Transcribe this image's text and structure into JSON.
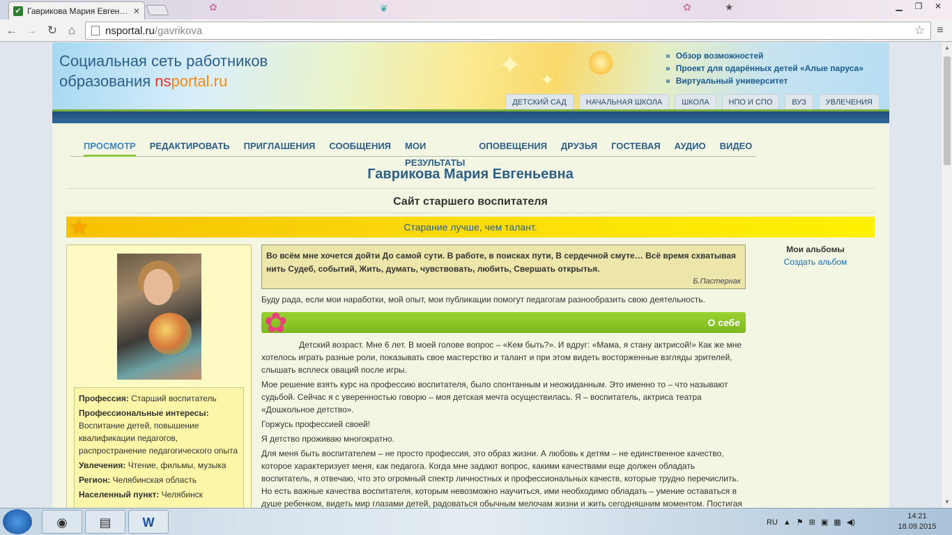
{
  "browser": {
    "tab_title": "Гаврикова Мария Евген…",
    "url_domain": "nsportal.ru",
    "url_path": "/gavrikova"
  },
  "site": {
    "brand_line1": "Социальная сеть работников",
    "brand_line2_prefix": "образования ",
    "brand_ns": "ns",
    "brand_portal": "portal.ru",
    "top_links": [
      "Обзор возможностей",
      "Проект для одарённых детей «Алые паруса»",
      "Виртуальный университет"
    ],
    "categories": [
      "ДЕТСКИЙ САД",
      "НАЧАЛЬНАЯ ШКОЛА",
      "ШКОЛА",
      "НПО И СПО",
      "ВУЗ",
      "УВЛЕЧЕНИЯ"
    ]
  },
  "profile_nav": [
    "ПРОСМОТР",
    "РЕДАКТИРОВАТЬ",
    "ПРИГЛАШЕНИЯ",
    "СООБЩЕНИЯ",
    "МОИ РЕЗУЛЬТАТЫ",
    "ОПОВЕЩЕНИЯ",
    "ДРУЗЬЯ",
    "ГОСТЕВАЯ",
    "АУДИО",
    "ВИДЕО"
  ],
  "profile": {
    "name": "Гаврикова Мария Евгеньевна",
    "site_title": "Сайт старшего воспитателя",
    "motto": "Старание лучше, чем талант.",
    "profession_label": "Профессия:",
    "profession": "Старший воспитатель",
    "interests_label": "Профессиональные интересы:",
    "interests": "Воспитание детей, повышение квалификации педагогов, распространение педагогического опыта",
    "hobbies_label": "Увлечения:",
    "hobbies": "Чтение, фильмы, музыка",
    "region_label": "Регион:",
    "region": "Челябинская область",
    "city_label": "Населенный пункт:",
    "city": "Челябинск"
  },
  "quote": {
    "text": "Во всём мне хочется дойти До самой сути. В работе, в поисках пути, В сердечной смуте… Всё время схватывая нить Судеб, событий, Жить, думать, чувствовать, любить, Свершать открытья.",
    "author": "Б.Пастернак"
  },
  "intro": "Буду рада, если мои наработки, мой опыт, мои публикации помогут педагогам разнообразить свою деятельность.",
  "about": {
    "label": "О себе",
    "paragraphs": [
      "Детский возраст. Мне 6 лет. В моей голове вопрос – «Кем быть?». И вдруг: «Мама, я стану актрисой!» Как же мне хотелось играть разные роли, показывать свое мастерство и талант и при этом видеть восторженные взгляды зрителей, слышать всплеск оваций после игры.",
      "Мое решение взять курс на профессию воспитателя, было спонтанным и неожиданным. Это именно то – что называют судьбой. Сейчас я с уверенностью говорю – моя детская мечта осуществилась. Я – воспитатель, актриса театра «Дошкольное детство».",
      "Горжусь профессией своей!",
      "Я детство проживаю многократно.",
      "Для меня быть воспитателем – не просто профессия, это образ жизни. А любовь к детям – не единственное качество, которое характеризует меня, как педагога. Когда мне задают вопрос, какими качествами еще должен обладать воспитатель, я отвечаю, что это огромный спектр личностных и профессиональных качеств, которые трудно перечислить. Но есть важные качества воспитателя, которым невозможно научиться, ими необходимо обладать – умение оставаться в душе ребенком, видеть мир глазами детей, радоваться обычным мелочам жизни и жить сегодняшним моментом. Постигая"
    ]
  },
  "albums": {
    "heading": "Мои альбомы",
    "create": "Создать альбом"
  },
  "taskbar": {
    "lang": "RU",
    "time": "14:21",
    "date": "18.09.2015"
  }
}
